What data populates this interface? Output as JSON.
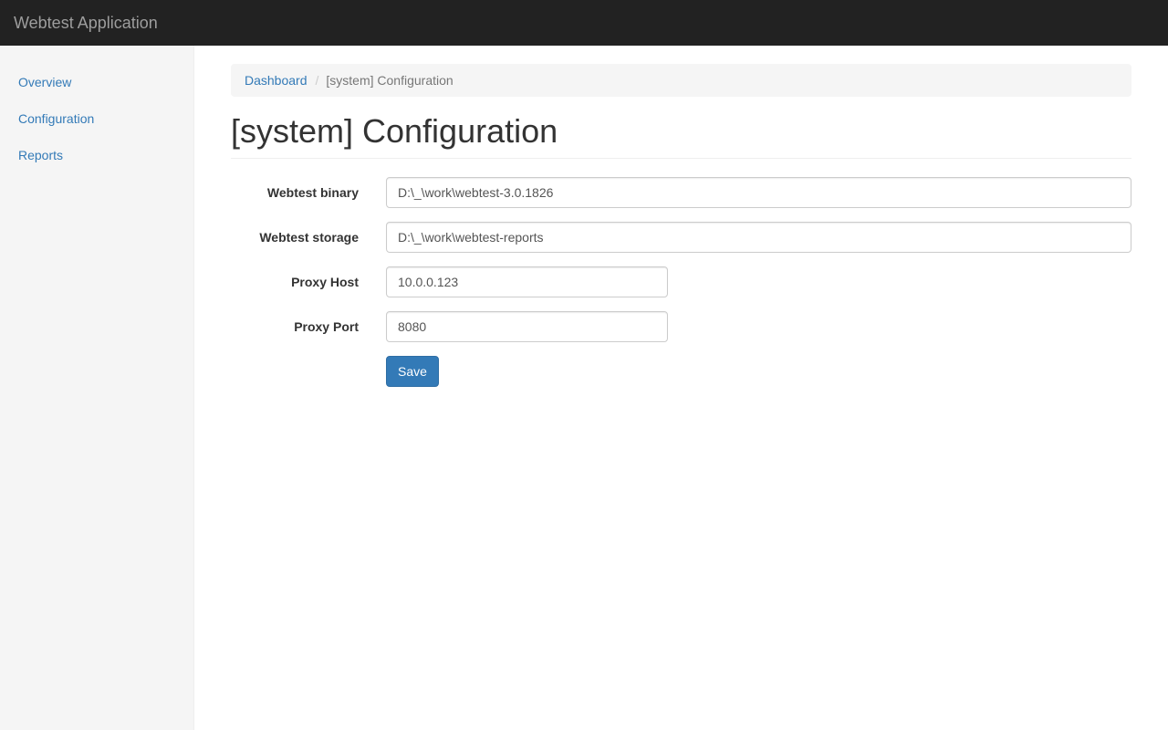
{
  "app": {
    "title": "Webtest Application"
  },
  "sidebar": {
    "items": [
      {
        "label": "Overview"
      },
      {
        "label": "Configuration"
      },
      {
        "label": "Reports"
      }
    ]
  },
  "breadcrumb": {
    "home": "Dashboard",
    "separator": "/",
    "current": "[system] Configuration"
  },
  "page": {
    "title": "[system] Configuration"
  },
  "form": {
    "fields": [
      {
        "label": "Webtest binary",
        "value": "D:\\_\\work\\webtest-3.0.1826"
      },
      {
        "label": "Webtest storage",
        "value": "D:\\_\\work\\webtest-reports"
      },
      {
        "label": "Proxy Host",
        "value": "10.0.0.123"
      },
      {
        "label": "Proxy Port",
        "value": "8080"
      }
    ],
    "save_label": "Save"
  },
  "colors": {
    "navbar": "#222222",
    "brand_text": "#9d9d9d",
    "link": "#337ab7",
    "primary_button": "#337ab7",
    "sidebar_bg": "#f5f5f5"
  }
}
